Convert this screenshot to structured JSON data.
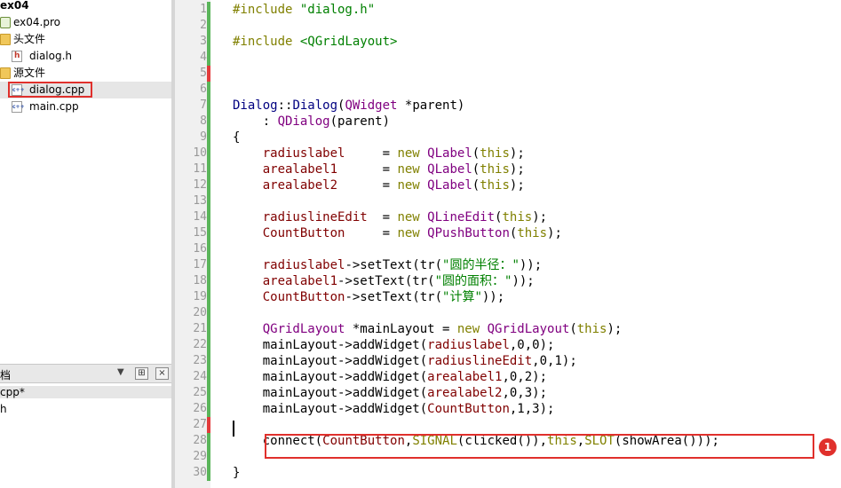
{
  "project_tree": {
    "project_name": "ex04",
    "project_file": "ex04.pro",
    "headers_folder": "头文件",
    "header_file": "dialog.h",
    "sources_folder": "源文件",
    "source_file_selected": "dialog.cpp",
    "source_file_main": "main.cpp"
  },
  "open_documents": {
    "title": "档",
    "items": [
      "cpp*",
      "h"
    ]
  },
  "editor": {
    "line_numbers": [
      "1",
      "2",
      "3",
      "4",
      "5",
      "6",
      "7",
      "8",
      "9",
      "10",
      "11",
      "12",
      "13",
      "14",
      "15",
      "16",
      "17",
      "18",
      "19",
      "20",
      "21",
      "22",
      "23",
      "24",
      "25",
      "26",
      "27",
      "28",
      "29",
      "30"
    ],
    "lines": [
      {
        "n": 1,
        "tokens": [
          [
            "kw",
            "#include "
          ],
          [
            "str",
            "\"dialog.h\""
          ]
        ]
      },
      {
        "n": 2,
        "tokens": []
      },
      {
        "n": 3,
        "tokens": [
          [
            "kw",
            "#include "
          ],
          [
            "str",
            "<QGridLayout>"
          ]
        ]
      },
      {
        "n": 4,
        "tokens": []
      },
      {
        "n": 5,
        "tokens": []
      },
      {
        "n": 6,
        "tokens": []
      },
      {
        "n": 7,
        "tokens": [
          [
            "inc",
            "Dialog"
          ],
          [
            "pn",
            "::"
          ],
          [
            "inc",
            "Dialog"
          ],
          [
            "pn",
            "("
          ],
          [
            "cls",
            "QWidget"
          ],
          [
            "pn",
            " *parent)"
          ]
        ]
      },
      {
        "n": 8,
        "tokens": [
          [
            "pn",
            "    : "
          ],
          [
            "cls",
            "QDialog"
          ],
          [
            "pn",
            "(parent)"
          ]
        ]
      },
      {
        "n": 9,
        "tokens": [
          [
            "pn",
            "{"
          ]
        ]
      },
      {
        "n": 10,
        "tokens": [
          [
            "pn",
            "    "
          ],
          [
            "vr",
            "radiuslabel"
          ],
          [
            "pn",
            "     = "
          ],
          [
            "kw",
            "new "
          ],
          [
            "cls",
            "QLabel"
          ],
          [
            "pn",
            "("
          ],
          [
            "kw",
            "this"
          ],
          [
            "pn",
            ");"
          ]
        ]
      },
      {
        "n": 11,
        "tokens": [
          [
            "pn",
            "    "
          ],
          [
            "vr",
            "arealabel1"
          ],
          [
            "pn",
            "      = "
          ],
          [
            "kw",
            "new "
          ],
          [
            "cls",
            "QLabel"
          ],
          [
            "pn",
            "("
          ],
          [
            "kw",
            "this"
          ],
          [
            "pn",
            ");"
          ]
        ]
      },
      {
        "n": 12,
        "tokens": [
          [
            "pn",
            "    "
          ],
          [
            "vr",
            "arealabel2"
          ],
          [
            "pn",
            "      = "
          ],
          [
            "kw",
            "new "
          ],
          [
            "cls",
            "QLabel"
          ],
          [
            "pn",
            "("
          ],
          [
            "kw",
            "this"
          ],
          [
            "pn",
            ");"
          ]
        ]
      },
      {
        "n": 13,
        "tokens": []
      },
      {
        "n": 14,
        "tokens": [
          [
            "pn",
            "    "
          ],
          [
            "vr",
            "radiuslineEdit"
          ],
          [
            "pn",
            "  = "
          ],
          [
            "kw",
            "new "
          ],
          [
            "cls",
            "QLineEdit"
          ],
          [
            "pn",
            "("
          ],
          [
            "kw",
            "this"
          ],
          [
            "pn",
            ");"
          ]
        ]
      },
      {
        "n": 15,
        "tokens": [
          [
            "pn",
            "    "
          ],
          [
            "vr",
            "CountButton"
          ],
          [
            "pn",
            "     = "
          ],
          [
            "kw",
            "new "
          ],
          [
            "cls",
            "QPushButton"
          ],
          [
            "pn",
            "("
          ],
          [
            "kw",
            "this"
          ],
          [
            "pn",
            ");"
          ]
        ]
      },
      {
        "n": 16,
        "tokens": []
      },
      {
        "n": 17,
        "tokens": [
          [
            "pn",
            "    "
          ],
          [
            "vr",
            "radiuslabel"
          ],
          [
            "pn",
            "->setText(tr("
          ],
          [
            "str",
            "\"圆的半径：\""
          ],
          [
            "pn",
            "));"
          ]
        ]
      },
      {
        "n": 18,
        "tokens": [
          [
            "pn",
            "    "
          ],
          [
            "vr",
            "arealabel1"
          ],
          [
            "pn",
            "->setText(tr("
          ],
          [
            "str",
            "\"圆的面积：\""
          ],
          [
            "pn",
            "));"
          ]
        ]
      },
      {
        "n": 19,
        "tokens": [
          [
            "pn",
            "    "
          ],
          [
            "vr",
            "CountButton"
          ],
          [
            "pn",
            "->setText(tr("
          ],
          [
            "str",
            "\"计算\""
          ],
          [
            "pn",
            "));"
          ]
        ]
      },
      {
        "n": 20,
        "tokens": []
      },
      {
        "n": 21,
        "tokens": [
          [
            "pn",
            "    "
          ],
          [
            "cls",
            "QGridLayout"
          ],
          [
            "pn",
            " *mainLayout = "
          ],
          [
            "kw",
            "new "
          ],
          [
            "cls",
            "QGridLayout"
          ],
          [
            "pn",
            "("
          ],
          [
            "kw",
            "this"
          ],
          [
            "pn",
            ");"
          ]
        ]
      },
      {
        "n": 22,
        "tokens": [
          [
            "pn",
            "    mainLayout->addWidget("
          ],
          [
            "vr",
            "radiuslabel"
          ],
          [
            "pn",
            ",0,0);"
          ]
        ]
      },
      {
        "n": 23,
        "tokens": [
          [
            "pn",
            "    mainLayout->addWidget("
          ],
          [
            "vr",
            "radiuslineEdit"
          ],
          [
            "pn",
            ",0,1);"
          ]
        ]
      },
      {
        "n": 24,
        "tokens": [
          [
            "pn",
            "    mainLayout->addWidget("
          ],
          [
            "vr",
            "arealabel1"
          ],
          [
            "pn",
            ",0,2);"
          ]
        ]
      },
      {
        "n": 25,
        "tokens": [
          [
            "pn",
            "    mainLayout->addWidget("
          ],
          [
            "vr",
            "arealabel2"
          ],
          [
            "pn",
            ",0,3);"
          ]
        ]
      },
      {
        "n": 26,
        "tokens": [
          [
            "pn",
            "    mainLayout->addWidget("
          ],
          [
            "vr",
            "CountButton"
          ],
          [
            "pn",
            ",1,3);"
          ]
        ]
      },
      {
        "n": 27,
        "tokens": []
      },
      {
        "n": 28,
        "tokens": [
          [
            "pn",
            "    connect("
          ],
          [
            "vr",
            "CountButton"
          ],
          [
            "pn",
            ","
          ],
          [
            "kw",
            "SIGNAL"
          ],
          [
            "pn",
            "(clicked()),"
          ],
          [
            "kw",
            "this"
          ],
          [
            "pn",
            ","
          ],
          [
            "kw",
            "SLOT"
          ],
          [
            "pn",
            "(showArea()));"
          ]
        ]
      },
      {
        "n": 29,
        "tokens": []
      },
      {
        "n": 30,
        "tokens": [
          [
            "pn",
            "}"
          ]
        ]
      }
    ]
  },
  "annotation": {
    "badge_label": "1"
  },
  "colors": {
    "highlight_box": "#e0302c",
    "change_marker_green": "#5ab55a",
    "change_marker_red": "#e23b3b",
    "keyword": "#808000",
    "class_name": "#800080",
    "string": "#008000",
    "member_variable": "#800000"
  }
}
